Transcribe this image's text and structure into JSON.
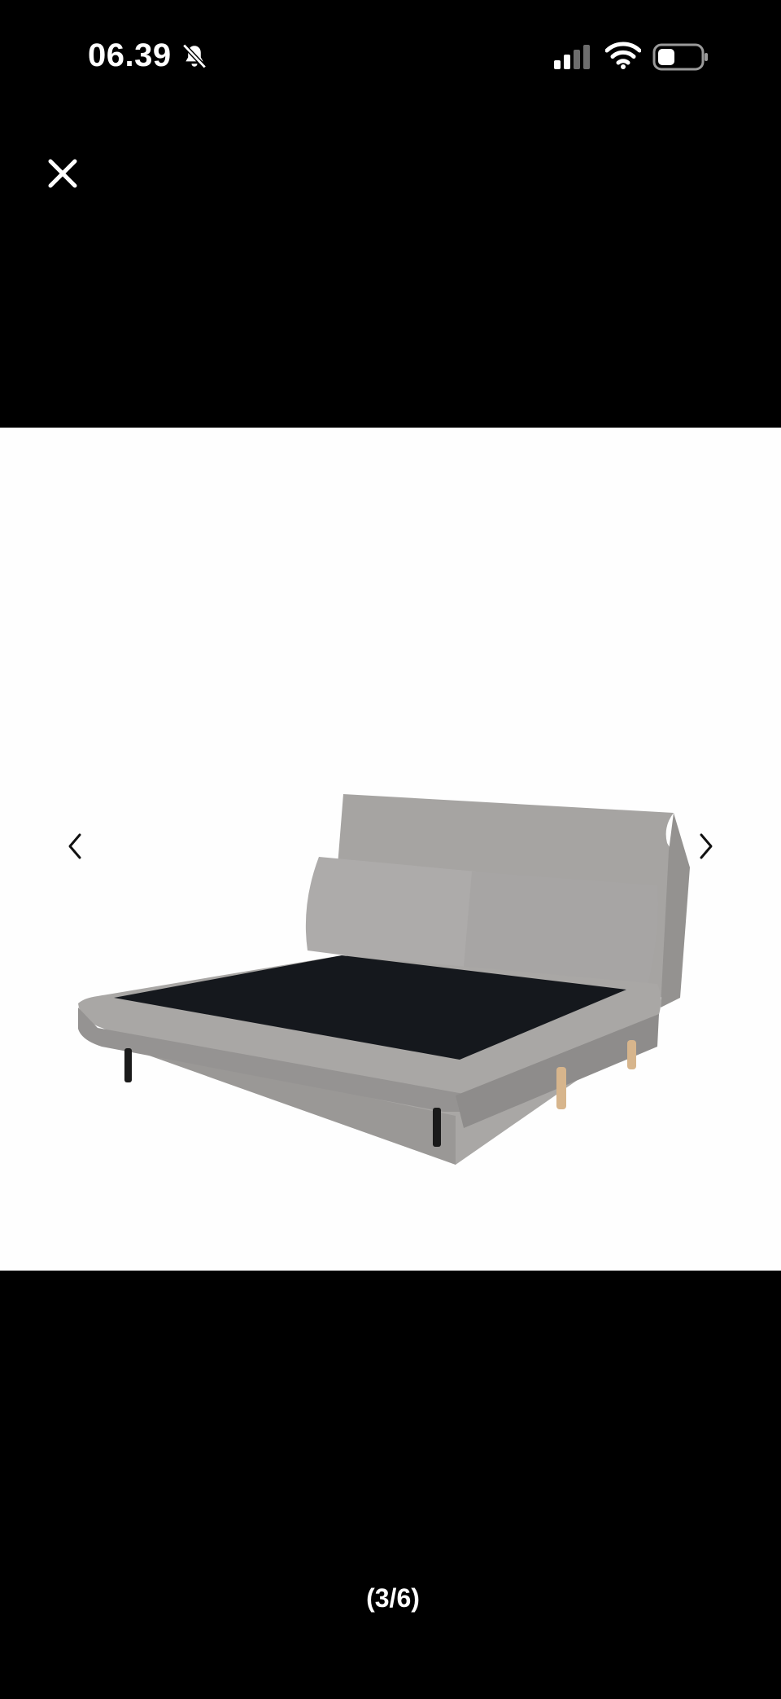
{
  "status_bar": {
    "time": "06.39",
    "icons": [
      "bell-slash-icon",
      "cellular-signal-icon",
      "wifi-icon",
      "battery-icon"
    ]
  },
  "viewer": {
    "close_icon": "close-icon",
    "prev_icon": "chevron-left-icon",
    "next_icon": "chevron-right-icon",
    "counter": "(3/6)"
  },
  "colors": {
    "background": "#000000",
    "image_background": "#fefefe",
    "fabric": "#a8a6a4",
    "mattress_base": "#15181d"
  }
}
